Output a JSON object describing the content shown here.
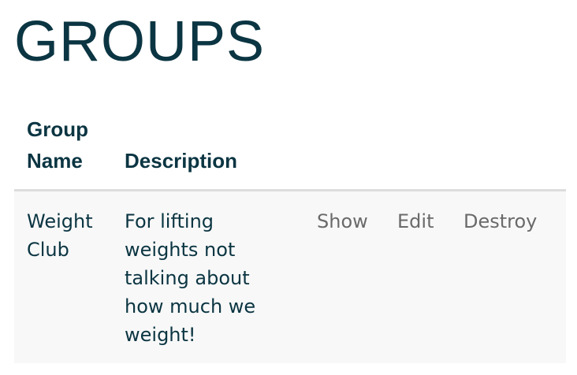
{
  "page": {
    "title": "GROUPS"
  },
  "table": {
    "headers": {
      "name": "Group Name",
      "description": "Description"
    },
    "rows": [
      {
        "name": "Weight Club",
        "description": "For lifting weights not talking about how much we weight!",
        "actions": {
          "show": "Show",
          "edit": "Edit",
          "destroy": "Destroy"
        }
      }
    ]
  },
  "colors": {
    "heading": "#0b3542",
    "link": "#6a6a6a",
    "row_background": "#f8f8f8",
    "header_rule": "#dddddd"
  }
}
